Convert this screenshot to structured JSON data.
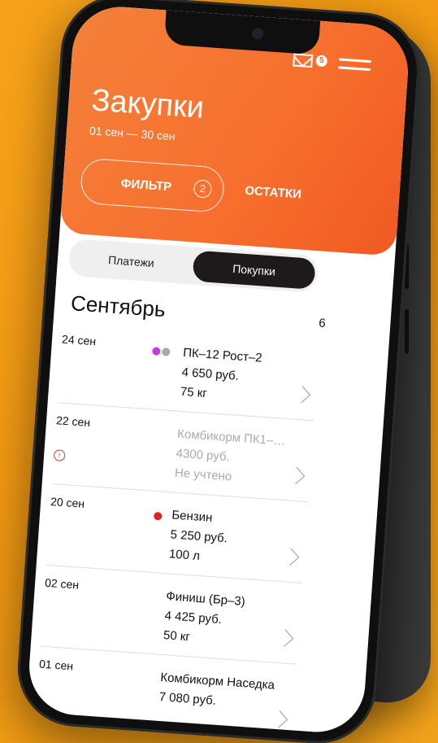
{
  "header": {
    "title": "Закупки",
    "period": "01 сен — 30 сен",
    "mail_badge": "5",
    "filter_label": "ФИЛЬТР",
    "filter_count": "2",
    "remains_label": "ОСТАТКИ"
  },
  "tabs": {
    "payments": "Платежи",
    "purchases": "Покупки"
  },
  "section": {
    "month": "Сентябрь",
    "count": "6"
  },
  "purchases": [
    {
      "date": "24 сен",
      "name": "ПК–12 Рост–2",
      "price": "4 650 руб.",
      "qty": "75 кг"
    },
    {
      "date": "22 сен",
      "name": "Комбикорм ПК1–…",
      "price": "4300 руб.",
      "qty": "Не учтено"
    },
    {
      "date": "20 сен",
      "name": "Бензин",
      "price": "5 250 руб.",
      "qty": "100 л"
    },
    {
      "date": "02 сен",
      "name": "Финиш (Бр–3)",
      "price": "4 425 руб.",
      "qty": "50 кг"
    },
    {
      "date": "01 сен",
      "name": "Комбикорм Наседка",
      "price": "7 080 руб.",
      "qty": ""
    }
  ],
  "colors": {
    "accent": "#f4733a",
    "dot_purple": "#c43ddc",
    "dot_gray": "#a8a8a8",
    "dot_red": "#e02424"
  }
}
